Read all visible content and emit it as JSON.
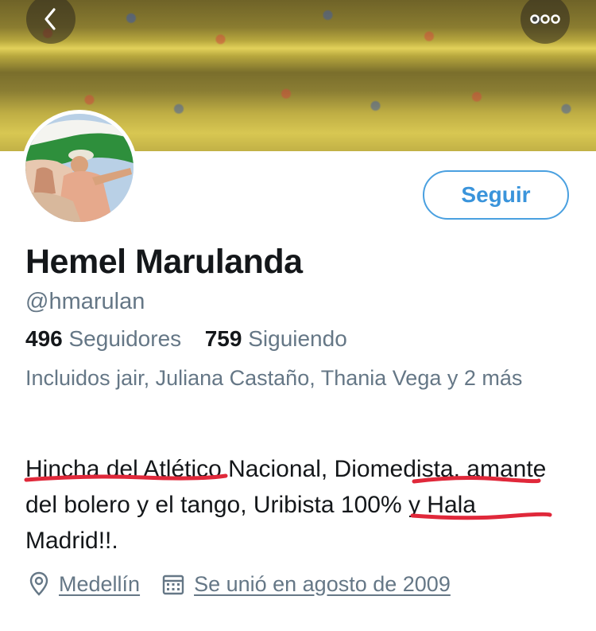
{
  "profile": {
    "name": "Hemel Marulanda",
    "handle": "@hmarulan",
    "followers_count": "496",
    "followers_label": "Seguidores",
    "following_count": "759",
    "following_label": "Siguiendo",
    "followed_by": "Incluidos jair, Juliana Castaño, Thania Vega y 2 más",
    "bio": "Hincha del Atlético Nacional, Diomedista, amante del bolero y el tango, Uribista 100% y Hala Madrid!!.",
    "location": "Medellín",
    "joined": "Se unió en agosto de 2009"
  },
  "actions": {
    "follow_label": "Seguir"
  },
  "icons": {
    "back": "back-chevron-icon",
    "more": "more-options-icon",
    "location": "location-pin-icon",
    "calendar": "calendar-icon"
  },
  "colors": {
    "accent": "#4aa0e0",
    "text_primary": "#14171a",
    "text_secondary": "#657786",
    "highlight_marker": "#e0283a"
  }
}
